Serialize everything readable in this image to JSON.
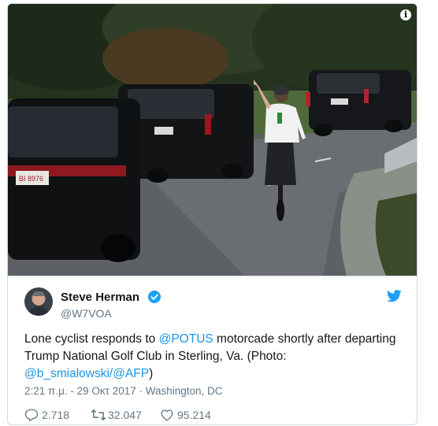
{
  "tweet": {
    "author_name": "Steve Herman",
    "author_handle": "@W7VOA",
    "text_before": "Lone cyclist responds to ",
    "mention_potus": "@POTUS",
    "text_middle": " motorcade shortly after departing Trump National Golf Club in Sterling, Va. (Photo: ",
    "mention_photographer": "@b_smialowski",
    "slash": "/",
    "mention_afp": "@AFP",
    "text_end": ")",
    "timestamp": "2:21 π.μ. - 29 Οκτ 2017 · Washington, DC",
    "replies": "2.718",
    "retweets": "32.047",
    "likes": "95.214"
  },
  "photo": {
    "plate_front_car": "BI 8976",
    "info_icon": "i"
  },
  "colors": {
    "link": "#1b95e0",
    "verified": "#1da1f2",
    "muted": "#657786",
    "text": "#14171a"
  },
  "icons": [
    "info-icon",
    "verified-badge-icon",
    "twitter-bird-icon",
    "reply-icon",
    "retweet-icon",
    "like-icon"
  ]
}
